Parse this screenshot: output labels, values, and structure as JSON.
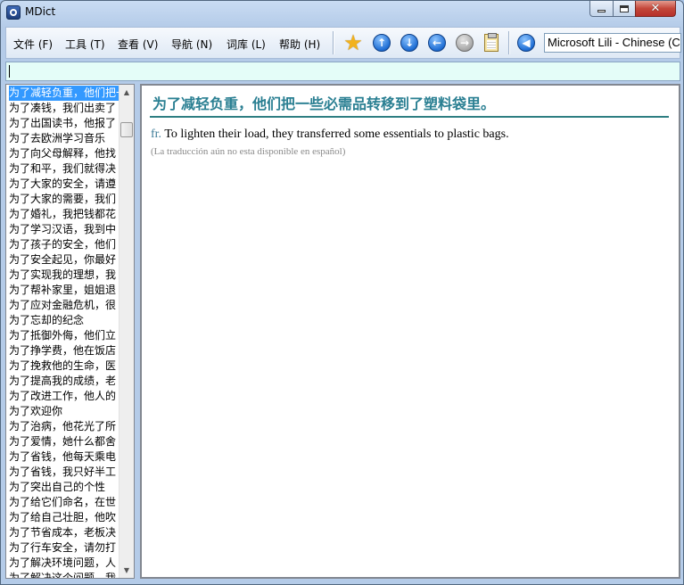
{
  "window": {
    "title": "MDict",
    "close_glyph": "✕"
  },
  "menu": [
    "文件 (F)",
    "工具 (T)",
    "查看 (V)",
    "导航 (N)",
    "词库 (L)",
    "帮助 (H)"
  ],
  "toolbar": {
    "voice_select": "Microsoft Lili - Chinese (C",
    "icons": [
      "favorite-star",
      "arrow-up",
      "arrow-down",
      "arrow-left",
      "arrow-right",
      "clipboard",
      "speaker"
    ]
  },
  "search": {
    "value": ""
  },
  "word_list": [
    "为了减轻负重，他们把一些必需品转移到了塑料袋里",
    "为了凑钱，我们出卖了",
    "为了出国读书，他报了",
    "为了去欧洲学习音乐",
    "为了向父母解释，他找",
    "为了和平，我们就得决",
    "为了大家的安全，请遵",
    "为了大家的需要，我们",
    "为了婚礼，我把钱都花",
    "为了学习汉语，我到中",
    "为了孩子的安全，他们",
    "为了安全起见，你最好",
    "为了实现我的理想，我",
    "为了帮补家里，姐姐退",
    "为了应对金融危机，很",
    "为了忘却的纪念",
    "为了抵御外侮，他们立",
    "为了挣学费，他在饭店",
    "为了挽救他的生命，医",
    "为了提高我的成绩，老",
    "为了改进工作，他人的",
    "为了欢迎你",
    "为了治病，他花光了所",
    "为了爱情，她什么都舍",
    "为了省钱，他每天乘电",
    "为了省钱，我只好半工",
    "为了突出自己的个性",
    "为了给它们命名，在世",
    "为了给自己壮胆，他吹",
    "为了节省成本，老板决",
    "为了行车安全，请勿打",
    "为了解决环境问题，人",
    "为了解决这个问题，我"
  ],
  "selected_index": 0,
  "entry": {
    "headword": "为了减轻负重，他们把一些必需品转移到了塑料袋里。",
    "lang_tag": "fr.",
    "definition": "To lighten their load, they transferred some essentials to plastic bags.",
    "note": "(La traducción aún no esta disponible en español)"
  },
  "colors": {
    "headword": "#2a7f92",
    "selection": "#3399ff",
    "search_bg": "#e4fdf8"
  }
}
